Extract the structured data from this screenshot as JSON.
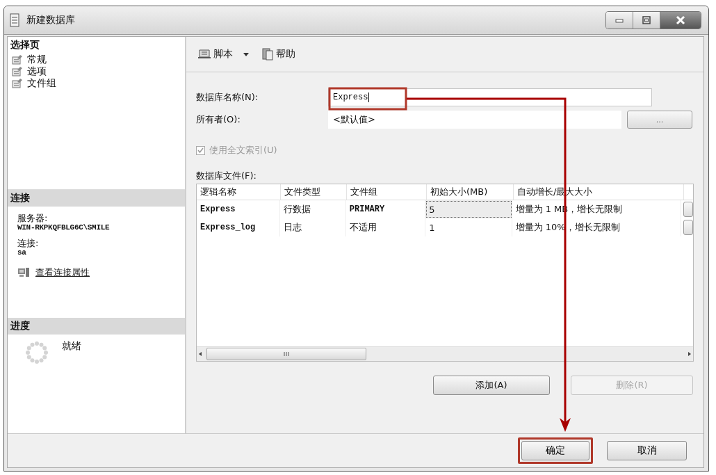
{
  "window": {
    "title": "新建数据库"
  },
  "sidebar": {
    "select_page": {
      "title": "选择页",
      "items": [
        {
          "label": "常规"
        },
        {
          "label": "选项"
        },
        {
          "label": "文件组"
        }
      ]
    },
    "connection": {
      "title": "连接",
      "server_label": "服务器:",
      "server": "WIN-RKPKQFBLG6C\\SMILE",
      "login_label": "连接:",
      "login": "sa",
      "link": "查看连接属性"
    },
    "progress": {
      "title": "进度",
      "status": "就绪"
    }
  },
  "toolbar": [
    {
      "label": "脚本",
      "kind": "dropdown"
    },
    {
      "label": "帮助",
      "kind": "plain"
    }
  ],
  "form": {
    "db_name": {
      "label": "数据库名称(N):",
      "value": "Express",
      "annotated": true
    },
    "owner": {
      "label": "所有者(O):",
      "value": "<默认值>",
      "button": "..."
    },
    "fulltext": {
      "label": "使用全文索引(U)",
      "checked": true,
      "disabled": true
    }
  },
  "files": {
    "label": "数据库文件(F):",
    "columns": [
      "逻辑名称",
      "文件类型",
      "文件组",
      "初始大小(MB)",
      "自动增长/最大大小"
    ],
    "rows": [
      {
        "cells": [
          {
            "text": "Express",
            "focused": false
          },
          {
            "text": "行数据",
            "focused": false
          },
          {
            "text": "PRIMARY",
            "focused": false
          },
          {
            "text": "5",
            "focused": true
          },
          {
            "text": "增量为 1 MB，增长无限制",
            "focused": false
          }
        ]
      },
      {
        "cells": [
          {
            "text": "Express_log",
            "focused": false
          },
          {
            "text": "日志",
            "focused": false
          },
          {
            "text": "不适用",
            "focused": false
          },
          {
            "text": "1",
            "focused": false
          },
          {
            "text": "增量为 10%，增长无限制",
            "focused": false
          }
        ]
      }
    ],
    "buttons": [
      {
        "label": "添加(A)",
        "disabled": false
      },
      {
        "label": "删除(R)",
        "disabled": true
      }
    ]
  },
  "footer": {
    "buttons": [
      {
        "label": "确定",
        "kind": "ok",
        "annotated": true
      },
      {
        "label": "取消",
        "kind": "cancel",
        "annotated": false
      }
    ]
  }
}
